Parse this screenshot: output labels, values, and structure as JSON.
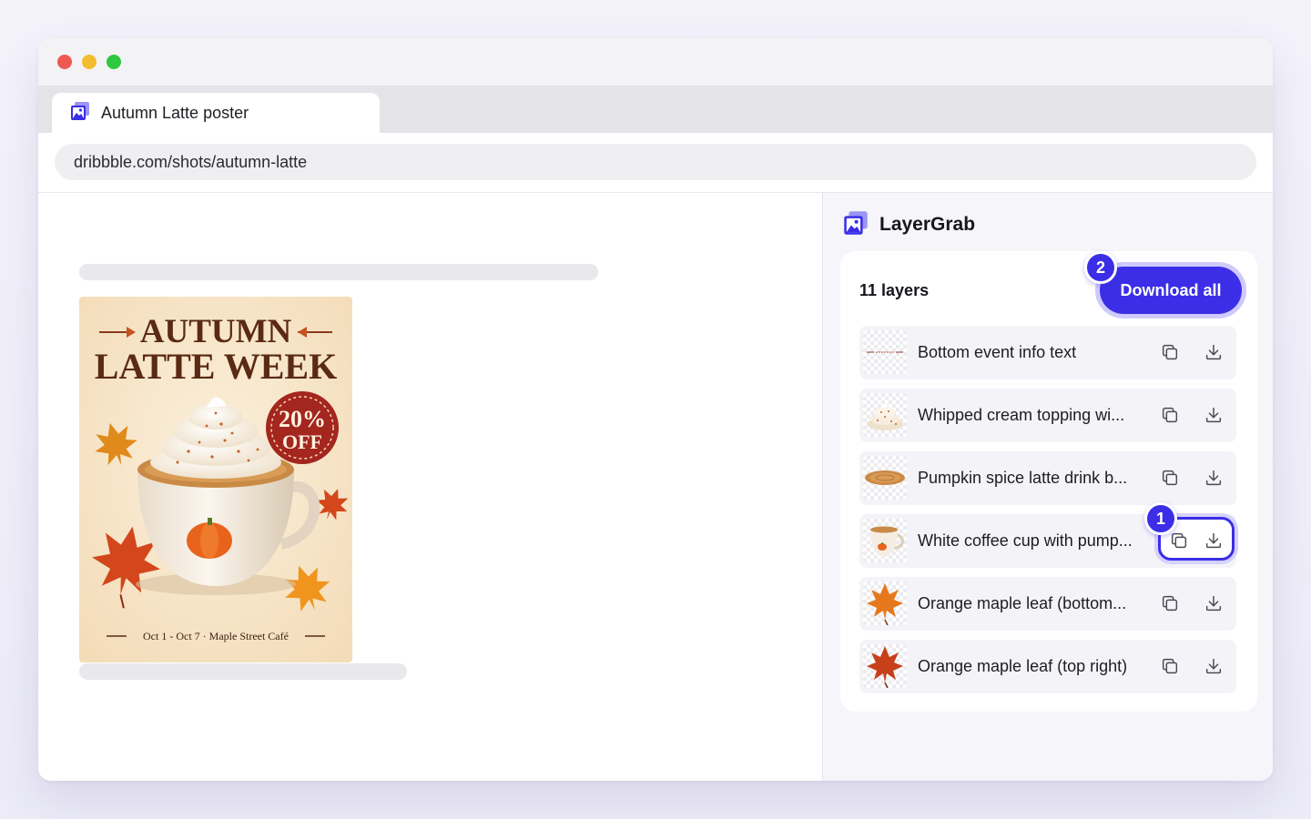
{
  "browser": {
    "tab_title": "Autumn Latte poster",
    "url": "dribbble.com/shots/autumn-latte"
  },
  "poster": {
    "headline_line1": "AUTUMN",
    "headline_line2": "LATTE WEEK",
    "discount_line1": "20%",
    "discount_line2": "OFF",
    "footer": "Oct 1 - Oct 7  ·  Maple Street Café"
  },
  "extension": {
    "name": "LayerGrab",
    "layer_count": "11 layers",
    "download_all_label": "Download all",
    "badge_download_all": "2",
    "badge_row_download": "1",
    "layers": [
      {
        "name": "Bottom event info text",
        "thumb": "text-strip"
      },
      {
        "name": "Whipped cream topping wi...",
        "thumb": "whipped-cream"
      },
      {
        "name": "Pumpkin spice latte drink b...",
        "thumb": "latte-drink"
      },
      {
        "name": "White coffee cup with pump...",
        "thumb": "coffee-cup"
      },
      {
        "name": "Orange maple leaf (bottom...",
        "thumb": "maple-leaf-orange"
      },
      {
        "name": "Orange maple leaf (top right)",
        "thumb": "maple-leaf-red"
      }
    ]
  },
  "colors": {
    "accent": "#3b2ee6",
    "poster_bg": "#f6e4c8",
    "poster_title": "#5a2a14",
    "badge_red": "#a3261f"
  },
  "icons": {
    "copy": "copy-icon",
    "download": "download-icon",
    "app": "layergrab-logo-icon"
  }
}
